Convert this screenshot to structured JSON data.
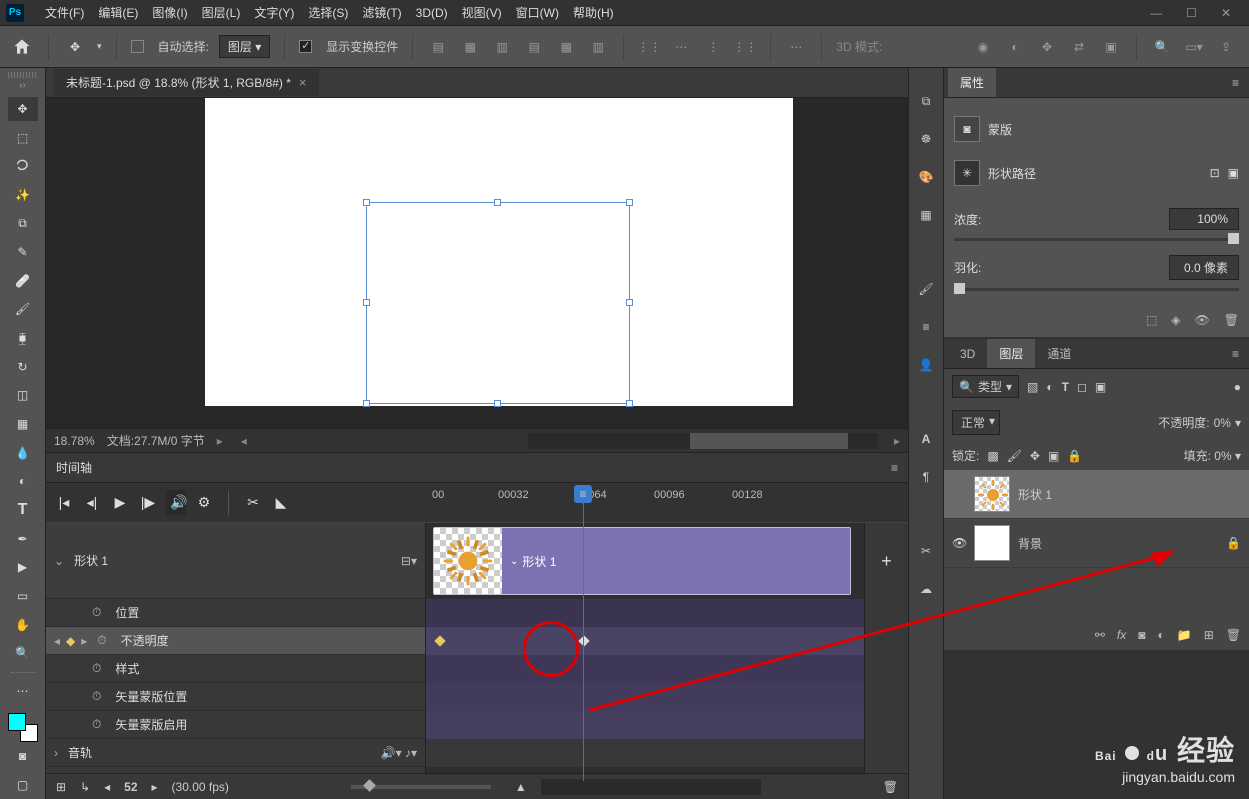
{
  "menu": {
    "items": [
      "文件(F)",
      "编辑(E)",
      "图像(I)",
      "图层(L)",
      "文字(Y)",
      "选择(S)",
      "滤镜(T)",
      "3D(D)",
      "视图(V)",
      "窗口(W)",
      "帮助(H)"
    ]
  },
  "optbar": {
    "auto_select": "自动选择:",
    "layer_dd": "图层",
    "show_transform": "显示变换控件",
    "mode_3d": "3D 模式:"
  },
  "doc": {
    "title": "未标题-1.psd @ 18.8% (形状 1, RGB/8#) *"
  },
  "status": {
    "zoom": "18.78%",
    "doc_info": "文档:27.7M/0 字节"
  },
  "timeline": {
    "title": "时间轴",
    "layer_name": "形状 1",
    "clip_name": "形状 1",
    "ruler": [
      "00",
      "00032",
      "00064",
      "00096",
      "00128"
    ],
    "props": {
      "position": "位置",
      "opacity": "不透明度",
      "style": "样式",
      "vector_mask_pos": "矢量蒙版位置",
      "vector_mask_enable": "矢量蒙版启用"
    },
    "audio": "音轨",
    "frame": "52",
    "fps": "(30.00 fps)"
  },
  "properties": {
    "title": "属性",
    "mask": "蒙版",
    "shape_path": "形状路径",
    "density": "浓度:",
    "density_val": "100%",
    "feather": "羽化:",
    "feather_val": "0.0 像素"
  },
  "layers": {
    "tabs": {
      "3d": "3D",
      "layers": "图层",
      "channels": "通道"
    },
    "filter": "类型",
    "blend": "正常",
    "opacity_label": "不透明度:",
    "opacity_val": "0%",
    "fill_label": "填充:",
    "fill_val": "0%",
    "lock": "锁定:",
    "layer1": "形状 1",
    "layer2": "背景"
  },
  "watermark": {
    "brand": "Baidu经验",
    "url": "jingyan.baidu.com"
  }
}
